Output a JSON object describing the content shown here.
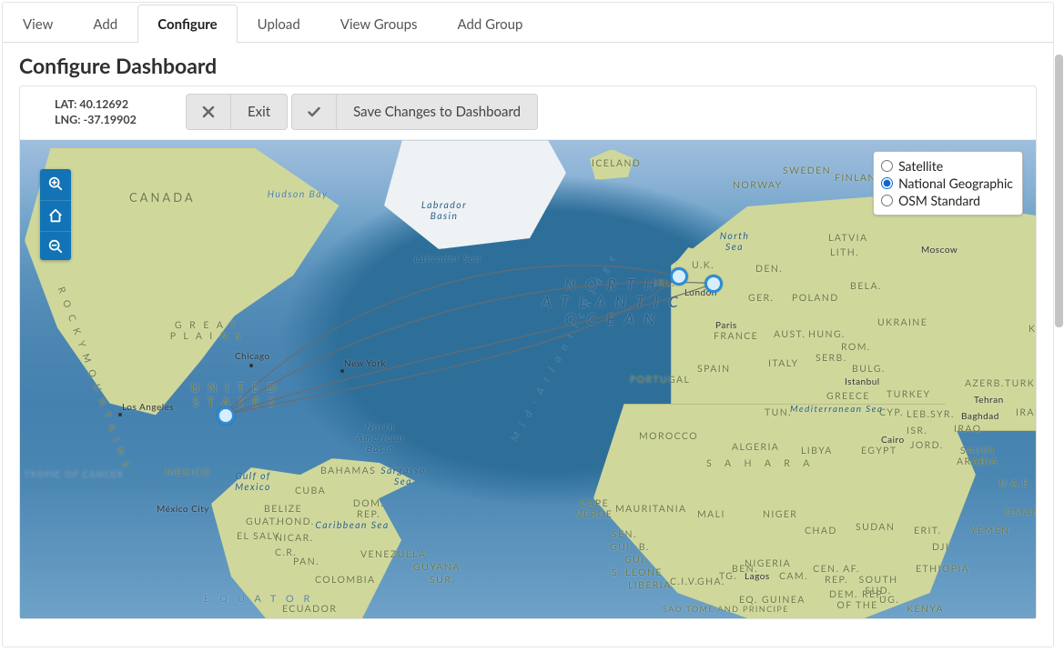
{
  "tabs": [
    {
      "label": "View"
    },
    {
      "label": "Add"
    },
    {
      "label": "Configure",
      "active": true
    },
    {
      "label": "Upload"
    },
    {
      "label": "View Groups"
    },
    {
      "label": "Add Group"
    }
  ],
  "heading": "Configure Dashboard",
  "coords": {
    "lat_label": "LAT: 40.12692",
    "lng_label": "LNG: -37.19902"
  },
  "toolbar": {
    "exit_label": "Exit",
    "save_label": "Save Changes to Dashboard"
  },
  "map_controls": {
    "zoom_in": "zoom-in",
    "home": "home",
    "zoom_out": "zoom-out"
  },
  "layers": {
    "options": [
      {
        "label": "Satellite",
        "selected": false
      },
      {
        "label": "National Geographic",
        "selected": true
      },
      {
        "label": "OSM Standard",
        "selected": false
      }
    ]
  },
  "map_labels": {
    "canada": "CANADA",
    "hudson_bay": "Hudson Bay",
    "labrador_sea": "Labrador Sea",
    "labrador_basin": "Labrador Basin",
    "iceland": "ICELAND",
    "north_sea": "North Sea",
    "uk": "U.K.",
    "irl": "IRL.",
    "london": "London",
    "norway": "NORWAY",
    "sweden": "SWEDEN",
    "finland": "FINLAND",
    "den": "DEN.",
    "ger": "GER.",
    "poland": "POLAND",
    "latvia": "LATVIA",
    "lith": "LITH.",
    "bela": "BELA.",
    "ukraine": "UKRAINE",
    "moscow": "Moscow",
    "ka": "KA",
    "aust": "AUST.",
    "hung": "HUNG.",
    "rom": "ROM.",
    "bulg": "BULG.",
    "serb": "SERB.",
    "italy": "ITALY",
    "france": "FRANCE",
    "paris": "Paris",
    "spain": "SPAIN",
    "portugal": "PORTUGAL",
    "greece": "GREECE",
    "turkey": "TURKEY",
    "istanbul": "Istanbul",
    "cyp": "CYP.",
    "leb": "LEB.",
    "syr": "SYR.",
    "isr": "ISR.",
    "jord": "JORD.",
    "iraq": "IRAQ",
    "iran": "IRAN",
    "turkm": "TURKM.",
    "azerb": "AZERB.",
    "tehran": "Tehran",
    "baghdad": "Baghdad",
    "saudi": "SAUDI ARABIA",
    "uae": "U.A.E.",
    "oman": "OMAN",
    "yemen": "YEMEN",
    "erit": "ERIT.",
    "dji": "DJI.",
    "ethiopia": "ETHIOPIA",
    "south_sud": "SOUTH SUD.",
    "sudan": "SUDAN",
    "egypt": "EGYPT",
    "cairo": "Cairo",
    "libya": "LIBYA",
    "algeria": "ALGERIA",
    "sahara": "S    A    H    A    R    A",
    "morocco": "MOROCCO",
    "tun": "TUN.",
    "med": "Mediterranean Sea",
    "mali": "MALI",
    "niger": "NIGER",
    "chad": "CHAD",
    "mauritania": "MAURITANIA",
    "sen": "SEN.",
    "gui": "GUI.",
    "gui_b": "GUI.-B.",
    "s_leone": "S. LEONE",
    "liberia": "LIBERIA",
    "civ": "C.I.V.",
    "ghana": "GHA.",
    "togo": "TG.",
    "benin": "BEN.",
    "nigeria": "NIGERIA",
    "lagos": "Lagos",
    "cam": "CAM.",
    "cen_af": "CEN. AF. REP.",
    "eq_guinea": "EQ. GUINEA",
    "dem_rep": "DEM. REP. OF THE",
    "ug": "UG.",
    "kenya": "KENYA",
    "sao_tome": "SAO TOME AND PRINCIPE",
    "cape_verde": "CAPE VERDE",
    "tropic": "TROPIC OF CANCER",
    "equator": "E Q U A T O R",
    "natl": "N O R T H\nA T L A N T I C\nO C E A N",
    "ridge": "M i d - A t l a n t i c   R i d g e",
    "great_plains": "G R E A T\nP L A I N S",
    "rocky": "R O C K Y   M O U N T A I N S",
    "us": "U N I T E D\nS T A T E S",
    "na_basin": "North American Basin",
    "mexico": "MEXICO",
    "mexico_city": "México City",
    "gulf_mex": "Gulf of Mexico",
    "belize": "BELIZE",
    "guat": "GUAT.",
    "hond": "HOND.",
    "el_salv": "EL SALV.",
    "nicar": "NICAR.",
    "cr": "C.R.",
    "pan": "PAN.",
    "cuba": "CUBA",
    "bahamas": "BAHAMAS",
    "sargasso": "Sargasso Sea",
    "dom_rep": "DOM. REP.",
    "caribbean": "Caribbean Sea",
    "venezuela": "VENEZUELA",
    "colombia": "COLOMBIA",
    "guyana": "GUYANA",
    "sur": "SUR.",
    "ecuador": "ECUADOR",
    "chicago": "Chicago",
    "new_york": "New York",
    "los_angeles": "Los Angeles"
  }
}
